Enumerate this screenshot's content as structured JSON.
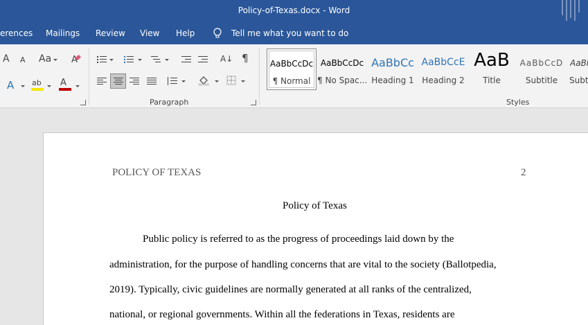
{
  "window": {
    "title": "Policy-of-Texas.docx  -  Word"
  },
  "menu": {
    "items": [
      "erences",
      "Mailings",
      "Review",
      "View",
      "Help"
    ],
    "tell_me": "Tell me what you want to do"
  },
  "ribbon": {
    "paragraph_label": "Paragraph",
    "styles_label": "Styles",
    "font_grow": "A",
    "font_shrink": "A",
    "change_case": "Aa",
    "pilcrow": "¶",
    "text_effects": "A",
    "highlight": "ab",
    "font_color": "A",
    "colors": {
      "highlight": "#f5e600",
      "font_color": "#c00000",
      "text_effects": "#2e75b6"
    },
    "styles": [
      {
        "preview": "AaBbCcDc",
        "name": "¶ Normal",
        "selected": true,
        "color": "#000000"
      },
      {
        "preview": "AaBbCcDc",
        "name": "¶ No Spac...",
        "selected": false,
        "color": "#000000"
      },
      {
        "preview": "AaBbCc",
        "name": "Heading 1",
        "selected": false,
        "color": "#2e74b5"
      },
      {
        "preview": "AaBbCcE",
        "name": "Heading 2",
        "selected": false,
        "color": "#2e74b5"
      },
      {
        "preview": "AaB",
        "name": "Title",
        "selected": false,
        "color": "#000000"
      },
      {
        "preview": "AaBbCcD",
        "name": "Subtitle",
        "selected": false,
        "color": "#595959"
      },
      {
        "preview": "AaBl",
        "name": "Subtl",
        "selected": false,
        "color": "#404040"
      }
    ]
  },
  "document": {
    "header": "POLICY OF TEXAS",
    "page_number": "2",
    "title": "Policy of Texas",
    "lines": [
      "Public policy is referred to as the progress of proceedings laid down by the",
      "administration, for the purpose of handling concerns that are vital to the society (Ballotpedia,",
      "2019). Typically, civic guidelines are normally generated at all ranks of the centralized,",
      "national, or regional governments. Within all the federations in Texas, residents are"
    ]
  }
}
